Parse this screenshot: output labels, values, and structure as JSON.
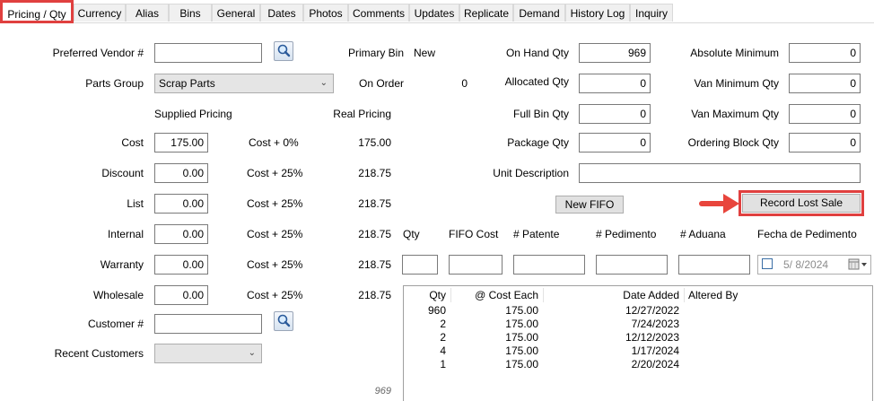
{
  "tabs": [
    "Pricing / Qty",
    "Currency",
    "Alias",
    "Bins",
    "General",
    "Dates",
    "Photos",
    "Comments",
    "Updates",
    "Replicate",
    "Demand",
    "History Log",
    "Inquiry"
  ],
  "vendor": {
    "label": "Preferred Vendor #",
    "value": ""
  },
  "parts_group": {
    "label": "Parts Group",
    "value": "Scrap Parts"
  },
  "primary_bin": {
    "label": "Primary Bin",
    "value": "New"
  },
  "on_order": {
    "label": "On Order",
    "value": "0"
  },
  "pricing": {
    "supplied_header": "Supplied Pricing",
    "real_header": "Real Pricing",
    "rows": [
      {
        "label": "Cost",
        "value": "175.00",
        "formula": "Cost + 0%",
        "real": "175.00"
      },
      {
        "label": "Discount",
        "value": "0.00",
        "formula": "Cost + 25%",
        "real": "218.75"
      },
      {
        "label": "List",
        "value": "0.00",
        "formula": "Cost + 25%",
        "real": "218.75"
      },
      {
        "label": "Internal",
        "value": "0.00",
        "formula": "Cost + 25%",
        "real": "218.75"
      },
      {
        "label": "Warranty",
        "value": "0.00",
        "formula": "Cost + 25%",
        "real": "218.75"
      },
      {
        "label": "Wholesale",
        "value": "0.00",
        "formula": "Cost + 25%",
        "real": "218.75"
      }
    ]
  },
  "customer": {
    "label": "Customer #",
    "value": ""
  },
  "recent_customers": {
    "label": "Recent Customers",
    "value": ""
  },
  "qty_fields": [
    {
      "label": "On Hand Qty",
      "value": "969"
    },
    {
      "label": "Allocated Qty",
      "value": "0"
    },
    {
      "label": "Full Bin Qty",
      "value": "0"
    },
    {
      "label": "Package Qty",
      "value": "0"
    }
  ],
  "limits": [
    {
      "label": "Absolute Minimum",
      "value": "0"
    },
    {
      "label": "Van Minimum Qty",
      "value": "0"
    },
    {
      "label": "Van Maximum Qty",
      "value": "0"
    },
    {
      "label": "Ordering Block Qty",
      "value": "0"
    }
  ],
  "unit_description": {
    "label": "Unit Description",
    "value": ""
  },
  "buttons": {
    "new_fifo": "New FIFO",
    "record_lost_sale": "Record Lost Sale"
  },
  "fifo_entry": {
    "qty": "Qty",
    "fifo_cost": "FIFO Cost",
    "patente": "# Patente",
    "pedimento": "# Pedimento",
    "aduana": "# Aduana",
    "fecha": "Fecha de Pedimento",
    "date_value": "5/  8/2024"
  },
  "fifo_table": {
    "headers": [
      "Qty",
      "@ Cost Each",
      "Date Added",
      "Altered By"
    ],
    "rows": [
      [
        "960",
        "175.00",
        "12/27/2022",
        ""
      ],
      [
        "2",
        "175.00",
        "7/24/2023",
        ""
      ],
      [
        "2",
        "175.00",
        "12/12/2023",
        ""
      ],
      [
        "4",
        "175.00",
        "1/17/2024",
        ""
      ],
      [
        "1",
        "175.00",
        "2/20/2024",
        ""
      ]
    ]
  },
  "fifo_total": "969",
  "colors": {
    "highlight": "#e0403f",
    "arrow": "#e8453c"
  },
  "icons": [
    "search-icon",
    "chevron-down-icon",
    "calendar-icon",
    "arrow-right-icon"
  ]
}
